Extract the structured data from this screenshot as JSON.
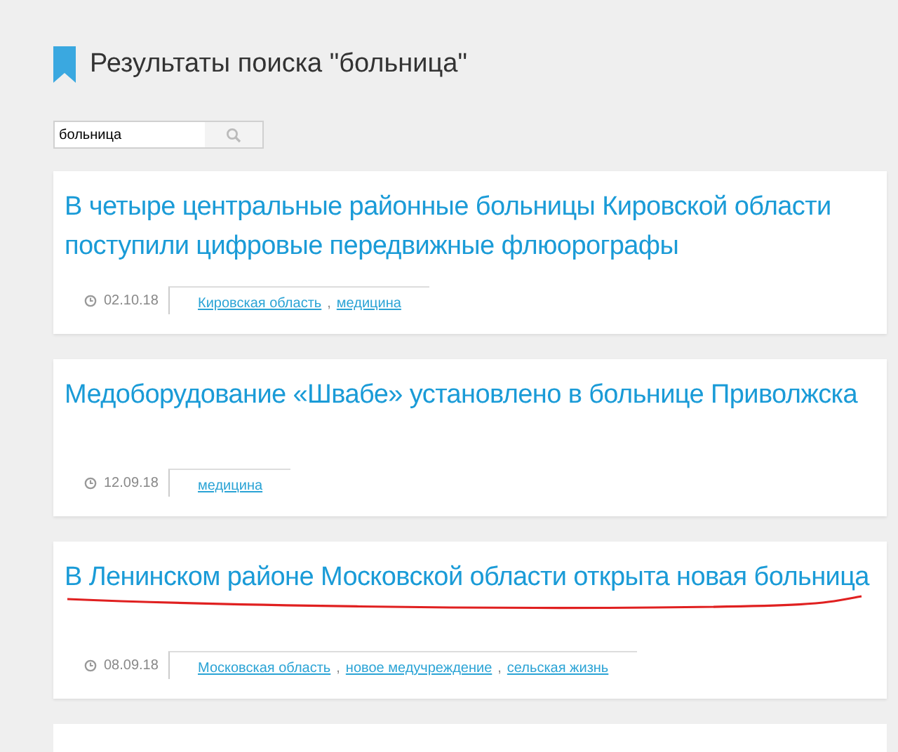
{
  "heading": "Результаты поиска \"больница\"",
  "search": {
    "value": "больница"
  },
  "tag_separator": ",",
  "results": [
    {
      "title": "В четыре центральные районные больницы Кировской области поступили цифровые передвижные флюорографы",
      "date": "02.10.18",
      "tags": [
        "Кировская область",
        "медицина"
      ],
      "underlined": false
    },
    {
      "title": "Медоборудование «Швабе» установлено в больнице Приволжска",
      "date": "12.09.18",
      "tags": [
        "медицина"
      ],
      "underlined": false
    },
    {
      "title": "В Ленинском районе Московской области открыта новая больница",
      "date": "08.09.18",
      "tags": [
        "Московская область",
        "новое медучреждение",
        "сельская жизнь"
      ],
      "underlined": true
    }
  ]
}
